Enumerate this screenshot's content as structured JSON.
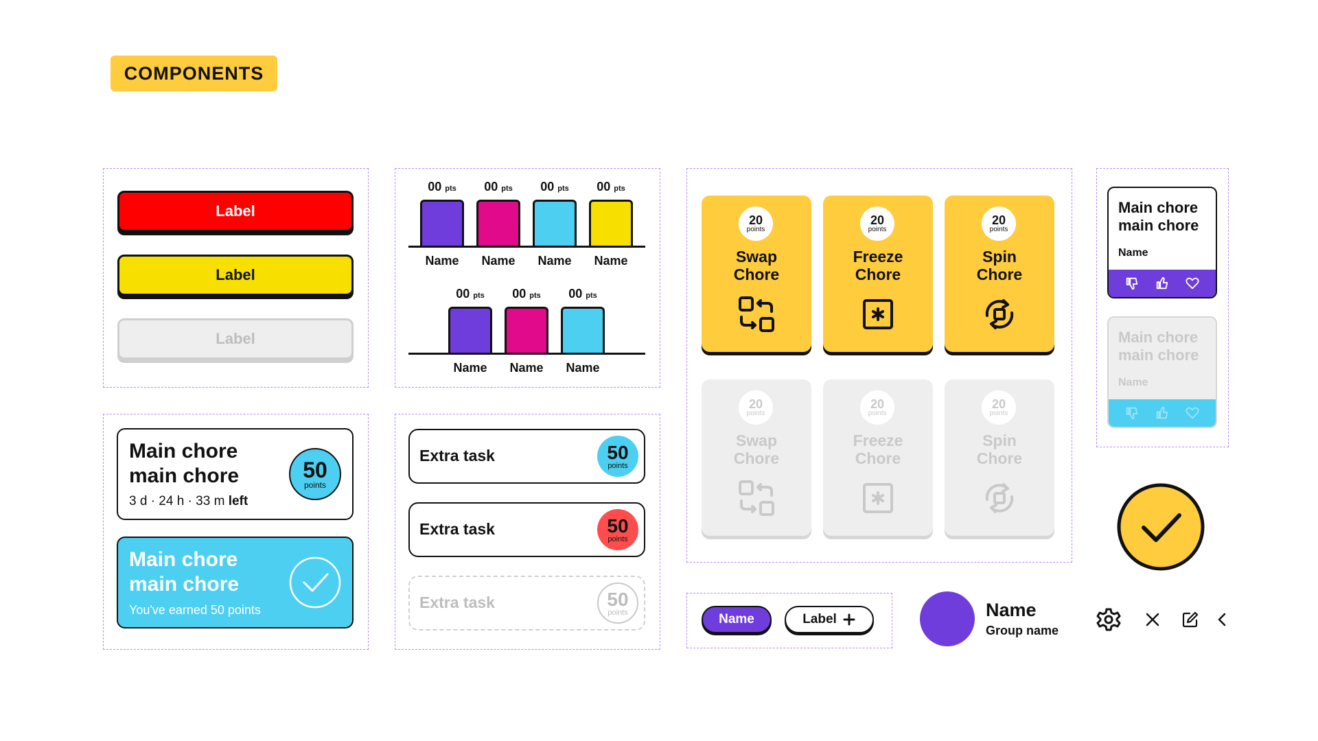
{
  "header": {
    "tag": "COMPONENTS"
  },
  "buttons": [
    {
      "label": "Label",
      "state": "primary-red"
    },
    {
      "label": "Label",
      "state": "primary-yellow"
    },
    {
      "label": "Label",
      "state": "disabled"
    }
  ],
  "leaderboard": {
    "top_row": [
      {
        "points": "00",
        "unit": "pts",
        "name": "Name",
        "color": "#6f3ddb"
      },
      {
        "points": "00",
        "unit": "pts",
        "name": "Name",
        "color": "#e10a8b"
      },
      {
        "points": "00",
        "unit": "pts",
        "name": "Name",
        "color": "#4dcff1"
      },
      {
        "points": "00",
        "unit": "pts",
        "name": "Name",
        "color": "#f7e000"
      }
    ],
    "bottom_row": [
      {
        "points": "00",
        "unit": "pts",
        "name": "Name",
        "color": "#6f3ddb"
      },
      {
        "points": "00",
        "unit": "pts",
        "name": "Name",
        "color": "#e10a8b"
      },
      {
        "points": "00",
        "unit": "pts",
        "name": "Name",
        "color": "#4dcff1"
      }
    ]
  },
  "power_cards": [
    {
      "points": "20",
      "unit": "points",
      "line1": "Swap",
      "line2": "Chore",
      "icon": "swap-icon"
    },
    {
      "points": "20",
      "unit": "points",
      "line1": "Freeze",
      "line2": "Chore",
      "icon": "freeze-icon"
    },
    {
      "points": "20",
      "unit": "points",
      "line1": "Spin",
      "line2": "Chore",
      "icon": "spin-icon"
    }
  ],
  "chore_cards": {
    "active": {
      "line1": "Main chore",
      "line2": "main chore",
      "countdown": "3 d · 24 h · 33 m",
      "left_label": "left",
      "points": "50",
      "unit": "points"
    },
    "done": {
      "line1": "Main chore",
      "line2": "main chore",
      "earned": "You've earned 50 points"
    }
  },
  "extra_tasks": [
    {
      "title": "Extra task",
      "points": "50",
      "unit": "points",
      "badge_color": "#4dcff1"
    },
    {
      "title": "Extra task",
      "points": "50",
      "unit": "points",
      "badge_color": "#ff4d4d"
    },
    {
      "title": "Extra task",
      "points": "50",
      "unit": "points",
      "badge_color": "#ffffff",
      "state": "disabled"
    }
  ],
  "mini_cards": [
    {
      "line1": "Main chore",
      "line2": "main chore",
      "name": "Name",
      "state": "active"
    },
    {
      "line1": "Main chore",
      "line2": "main chore",
      "name": "Name",
      "state": "disabled"
    }
  ],
  "pills": {
    "name": "Name",
    "label": "Label"
  },
  "profile": {
    "name": "Name",
    "group": "Group name"
  },
  "colors": {
    "yellow": "#ffcc3d",
    "purple": "#6f3ddb",
    "cyan": "#4dcff1",
    "magenta": "#e10a8b",
    "red": "#ff0000",
    "dashed": "#b98cf2"
  },
  "icons": [
    "gear-icon",
    "close-icon",
    "edit-icon",
    "chevron-left-icon",
    "check-icon",
    "thumbs-down-icon",
    "thumbs-up-icon",
    "heart-icon"
  ]
}
